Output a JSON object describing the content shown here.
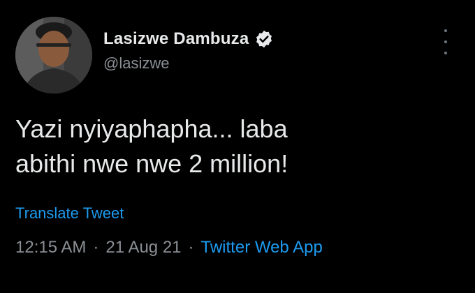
{
  "author": {
    "display_name": "Lasizwe Dambuza",
    "handle": "@lasizwe",
    "verified": true
  },
  "tweet": {
    "text": "Yazi nyiyaphapha... laba\nabithi nwe nwe 2 million!",
    "translate_label": "Translate Tweet",
    "time": "12:15 AM",
    "date": "21 Aug 21",
    "separator": "·",
    "source": "Twitter Web App"
  },
  "icons": {
    "verified": "verified-badge-icon",
    "more": "more-options-icon"
  },
  "colors": {
    "background": "#000000",
    "primary_text": "#e7e9ea",
    "secondary_text": "#8b8f94",
    "link": "#1d9bf0"
  }
}
